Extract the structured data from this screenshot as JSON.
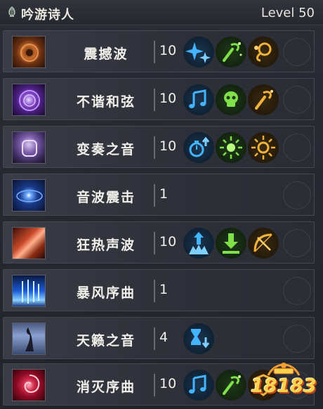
{
  "header": {
    "class_name": "吟游诗人",
    "level": "Level 50",
    "class_icon": "lyre-emblem-icon"
  },
  "skills": [
    {
      "name": "震撼波",
      "points": "10",
      "icon": "shockwave-skill-icon",
      "runes": [
        "blue-sparkle-rune-icon",
        "green-wand-rune-icon",
        "orange-spiral-rune-icon"
      ]
    },
    {
      "name": "不谐和弦",
      "points": "10",
      "icon": "discord-skill-icon",
      "runes": [
        "blue-music-note-rune-icon",
        "green-skull-rune-icon",
        "orange-wand-rune-icon"
      ]
    },
    {
      "name": "变奏之音",
      "points": "10",
      "icon": "variation-skill-icon",
      "runes": [
        "blue-stopwatch-rune-icon",
        "green-burst-rune-icon",
        "orange-sun-rune-icon"
      ]
    },
    {
      "name": "音波震击",
      "points": "1",
      "icon": "sonic-strike-skill-icon",
      "runes": []
    },
    {
      "name": "狂热声波",
      "points": "10",
      "icon": "frenzy-wave-skill-icon",
      "runes": [
        "blue-up-burst-rune-icon",
        "green-down-arrow-rune-icon",
        "orange-bow-rune-icon"
      ]
    },
    {
      "name": "暴风序曲",
      "points": "1",
      "icon": "storm-prelude-skill-icon",
      "runes": []
    },
    {
      "name": "天籁之音",
      "points": "4",
      "icon": "heavenly-sound-skill-icon",
      "runes": [
        "blue-hourglass-rune-icon"
      ]
    },
    {
      "name": "消灭序曲",
      "points": "10",
      "icon": "annihilation-prelude-skill-icon",
      "runes": [
        "blue-music-note-rune-icon",
        "green-wand-rune-icon",
        "orange-shield-rune-icon"
      ]
    }
  ],
  "watermark": {
    "text": "18183"
  },
  "colors": {
    "blue_rune": "#2f9be8",
    "green_rune": "#6fd23a",
    "orange_rune": "#f0a630"
  }
}
